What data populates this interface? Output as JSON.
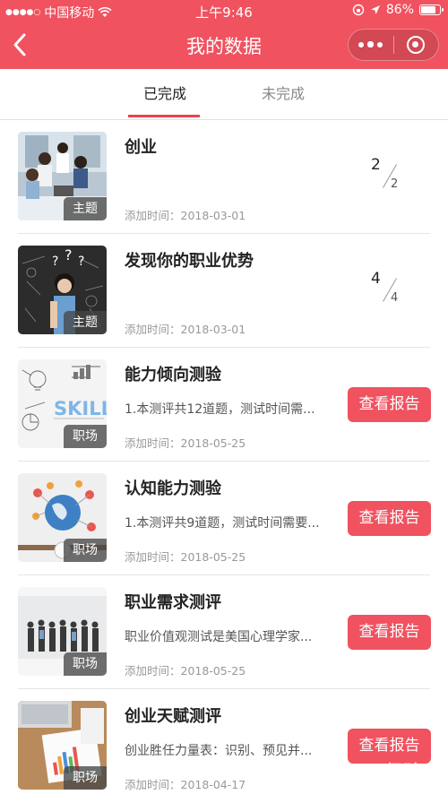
{
  "status_bar": {
    "carrier": "中国移动",
    "time": "上午9:46",
    "battery_text": "86%",
    "battery_level": 0.86
  },
  "nav": {
    "title": "我的数据",
    "back_icon": "chevron-left-icon",
    "more_icon": "more-dots-icon",
    "close_icon": "target-circle-icon"
  },
  "tabs": [
    {
      "label": "已完成",
      "active": true
    },
    {
      "label": "未完成",
      "active": false
    }
  ],
  "colors": {
    "brand": "#f0525f",
    "underline": "#e8444e"
  },
  "items": [
    {
      "title": "创业",
      "tag": "主题",
      "date_label": "添加时间：",
      "date": "2018-03-01",
      "desc": "",
      "progress_done": "2",
      "progress_total": "2",
      "button": ""
    },
    {
      "title": "发现你的职业优势",
      "tag": "主题",
      "date_label": "添加时间：",
      "date": "2018-03-01",
      "desc": "",
      "progress_done": "4",
      "progress_total": "4",
      "button": ""
    },
    {
      "title": "能力倾向测验",
      "tag": "职场",
      "date_label": "添加时间：",
      "date": "2018-05-25",
      "desc": "1.本测评共12道题，测试时间需...",
      "progress_done": "",
      "progress_total": "",
      "button": "查看报告"
    },
    {
      "title": "认知能力测验",
      "tag": "职场",
      "date_label": "添加时间：",
      "date": "2018-05-25",
      "desc": "1.本测评共9道题，测试时间需要...",
      "progress_done": "",
      "progress_total": "",
      "button": "查看报告"
    },
    {
      "title": "职业需求测评",
      "tag": "职场",
      "date_label": "添加时间：",
      "date": "2018-05-25",
      "desc": "职业价值观测试是美国心理学家...",
      "progress_done": "",
      "progress_total": "",
      "button": "查看报告"
    },
    {
      "title": "创业天赋测评",
      "tag": "职场",
      "date_label": "添加时间：",
      "date": "2018-04-17",
      "desc": "创业胜任力量表：识别、预见并...",
      "progress_done": "",
      "progress_total": "",
      "button": "查看报告"
    }
  ],
  "watermark": "Bai经验"
}
